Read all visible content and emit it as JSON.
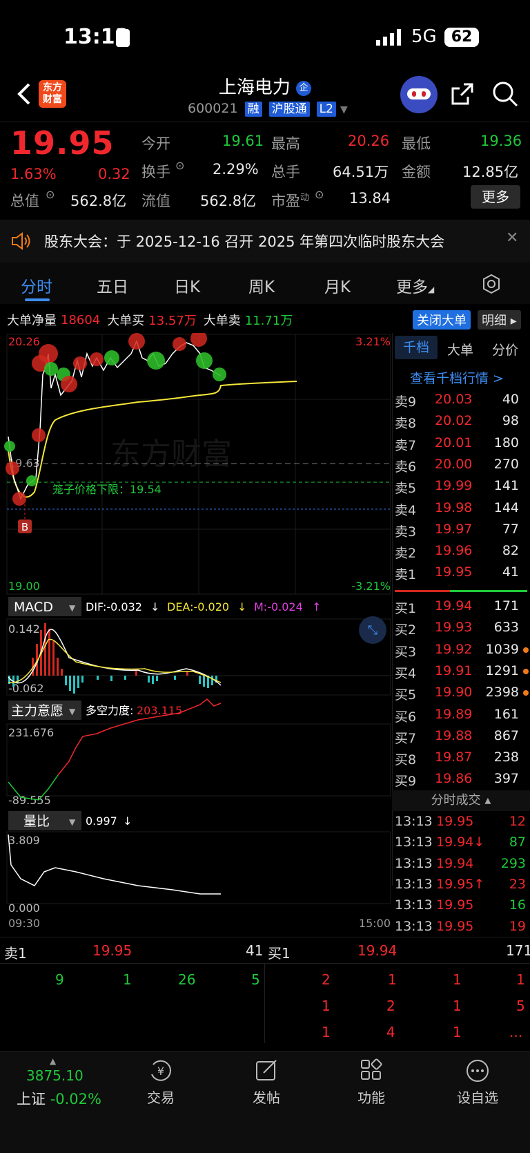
{
  "status": {
    "time": "13:13",
    "network": "5G",
    "battery": "62"
  },
  "header": {
    "logo_text": "东方财富",
    "title": "上海电力",
    "title_badge": "企",
    "code": "600021",
    "tags": [
      "融",
      "沪股通",
      "L2"
    ]
  },
  "quote": {
    "price": "19.95",
    "change_pct": "1.63%",
    "change": "0.32",
    "open_label": "今开",
    "open": "19.61",
    "high_label": "最高",
    "high": "20.26",
    "low_label": "最低",
    "low": "19.36",
    "turnover_label": "换手",
    "turnover": "2.29%",
    "volume_label": "总手",
    "volume": "64.51万",
    "amount_label": "金额",
    "amount": "12.85亿",
    "mktcap_label": "总值",
    "mktcap": "562.8亿",
    "float_label": "流值",
    "float": "562.8亿",
    "pe_label": "市盈",
    "pe_sup": "动",
    "pe": "13.84",
    "more": "更多"
  },
  "notice": {
    "text": "股东大会：于 2025-12-16 召开 2025 年第四次临时股东大会"
  },
  "tabs": [
    "分时",
    "五日",
    "日K",
    "周K",
    "月K",
    "更多"
  ],
  "bigorder": {
    "net_label": "大单净量",
    "net": "18604",
    "buy_label": "大单买",
    "buy": "13.57万",
    "sell_label": "大单卖",
    "sell": "11.71万",
    "close_btn": "关闭大单",
    "detail_btn": "明细"
  },
  "chart": {
    "price_top": "20.26",
    "price_bottom": "19.00",
    "pct_top": "3.21%",
    "pct_bottom": "-3.21%",
    "prev_close": "19.63",
    "limit_label": "笼子价格下限：19.54",
    "b_marker": "B",
    "watermark": "东方财富",
    "macd": {
      "name": "MACD",
      "dif": "DIF:-0.032",
      "dea": "DEA:-0.020",
      "m": "M:-0.024",
      "top": "0.142",
      "bottom": "-0.062"
    },
    "intent": {
      "name": "主力意愿",
      "value_label": "多空力度:",
      "value": "203.115",
      "top": "231.676",
      "bottom": "-89.555"
    },
    "volratio": {
      "name": "量比",
      "value": "0.997",
      "top": "3.809",
      "bottom": "0.000"
    },
    "time_start": "09:30",
    "time_end": "15:00"
  },
  "depth_tabs": [
    "千档",
    "大单",
    "分价"
  ],
  "depth_link": "查看千档行情 >",
  "asks": [
    {
      "label": "卖9",
      "price": "20.03",
      "vol": "40"
    },
    {
      "label": "卖8",
      "price": "20.02",
      "vol": "98"
    },
    {
      "label": "卖7",
      "price": "20.01",
      "vol": "180"
    },
    {
      "label": "卖6",
      "price": "20.00",
      "vol": "270"
    },
    {
      "label": "卖5",
      "price": "19.99",
      "vol": "141"
    },
    {
      "label": "卖4",
      "price": "19.98",
      "vol": "144"
    },
    {
      "label": "卖3",
      "price": "19.97",
      "vol": "77"
    },
    {
      "label": "卖2",
      "price": "19.96",
      "vol": "82"
    },
    {
      "label": "卖1",
      "price": "19.95",
      "vol": "41"
    }
  ],
  "bids": [
    {
      "label": "买1",
      "price": "19.94",
      "vol": "171"
    },
    {
      "label": "买2",
      "price": "19.93",
      "vol": "633"
    },
    {
      "label": "买3",
      "price": "19.92",
      "vol": "1039"
    },
    {
      "label": "买4",
      "price": "19.91",
      "vol": "1291"
    },
    {
      "label": "买5",
      "price": "19.90",
      "vol": "2398"
    },
    {
      "label": "买6",
      "price": "19.89",
      "vol": "161"
    },
    {
      "label": "买7",
      "price": "19.88",
      "vol": "867"
    },
    {
      "label": "买8",
      "price": "19.87",
      "vol": "238"
    },
    {
      "label": "买9",
      "price": "19.86",
      "vol": "397"
    }
  ],
  "ticks_title": "分时成交",
  "ticks": [
    {
      "time": "13:13",
      "price": "19.95",
      "vol": "12"
    },
    {
      "time": "13:13",
      "price": "19.94↓",
      "vol": "87"
    },
    {
      "time": "13:13",
      "price": "19.94",
      "vol": "293"
    },
    {
      "time": "13:13",
      "price": "19.95↑",
      "vol": "23"
    },
    {
      "time": "13:13",
      "price": "19.95",
      "vol": "16"
    },
    {
      "time": "13:13",
      "price": "19.95",
      "vol": "19"
    }
  ],
  "level": {
    "sell_label": "卖1",
    "sell_price": "19.95",
    "sell_vol": "41",
    "buy_label": "买1",
    "buy_price": "19.94",
    "buy_vol": "171",
    "sell_queue": [
      "9",
      "1",
      "26",
      "5"
    ],
    "buy_queue_1": [
      "2",
      "1",
      "1",
      "1"
    ],
    "buy_queue_2": [
      "1",
      "2",
      "1",
      "5"
    ],
    "buy_queue_3": [
      "1",
      "4",
      "1",
      "..."
    ]
  },
  "footer": {
    "index_value": "3875.10",
    "index_name": "上证",
    "index_change": "-0.02%",
    "items": [
      "交易",
      "发帖",
      "功能",
      "设自选"
    ]
  },
  "colors": {
    "up": "#f0282d",
    "down": "#1fc93a",
    "accent": "#1f6fe0"
  }
}
